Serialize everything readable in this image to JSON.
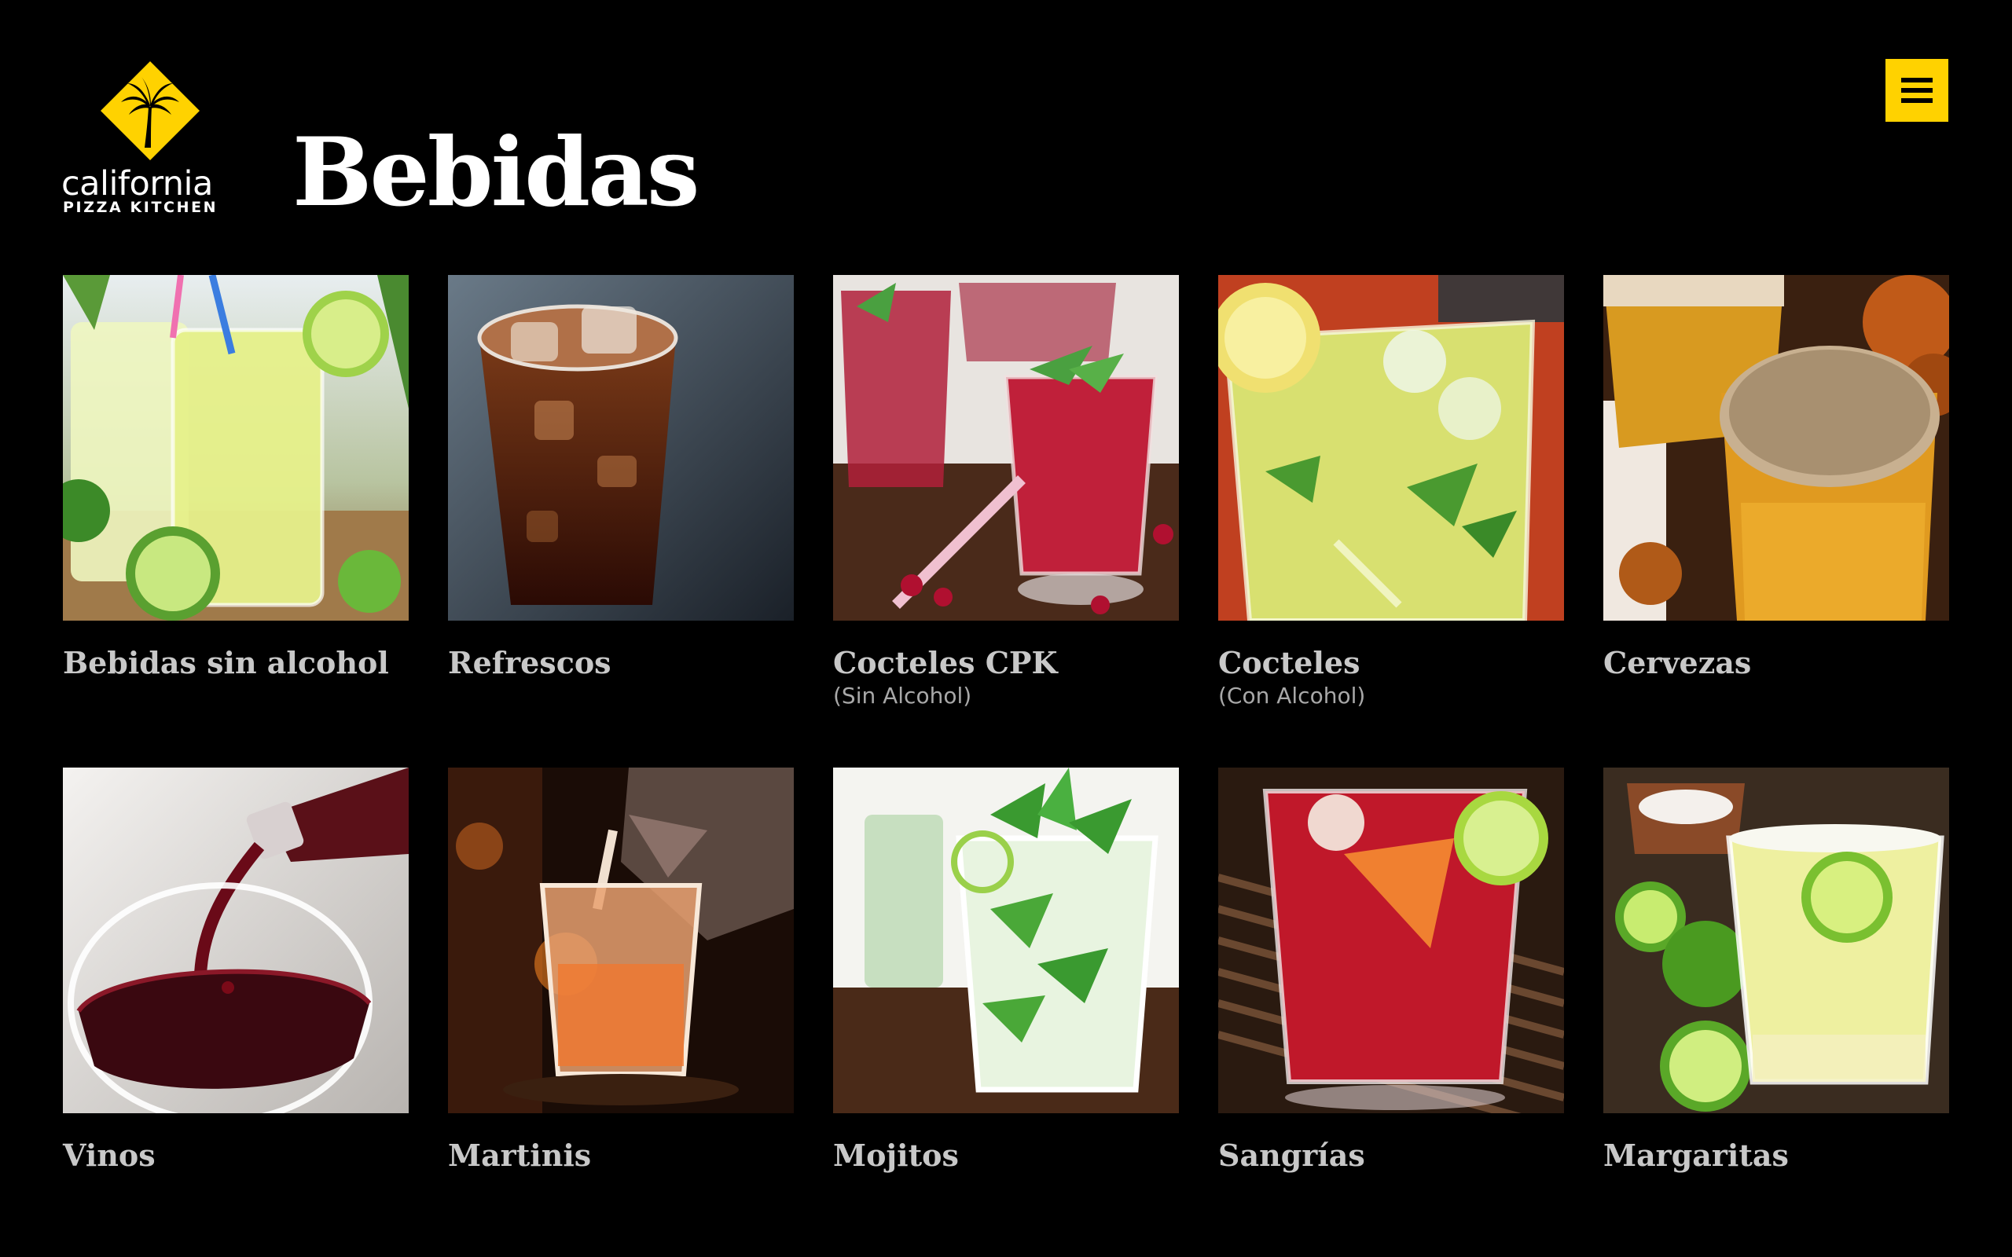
{
  "brand": {
    "name_line1": "california",
    "name_line2": "PIZZA KITCHEN",
    "accent_color": "#ffd200"
  },
  "header": {
    "title": "Bebidas",
    "menu_icon": "hamburger-menu-icon"
  },
  "tiles": [
    {
      "label": "Bebidas sin alcohol",
      "sublabel": ""
    },
    {
      "label": "Refrescos",
      "sublabel": ""
    },
    {
      "label": "Cocteles CPK",
      "sublabel": "(Sin Alcohol)"
    },
    {
      "label": "Cocteles",
      "sublabel": "(Con Alcohol)"
    },
    {
      "label": "Cervezas",
      "sublabel": ""
    },
    {
      "label": "Vinos",
      "sublabel": ""
    },
    {
      "label": "Martinis",
      "sublabel": ""
    },
    {
      "label": "Mojitos",
      "sublabel": ""
    },
    {
      "label": "Sangrías",
      "sublabel": ""
    },
    {
      "label": "Margaritas",
      "sublabel": ""
    }
  ]
}
